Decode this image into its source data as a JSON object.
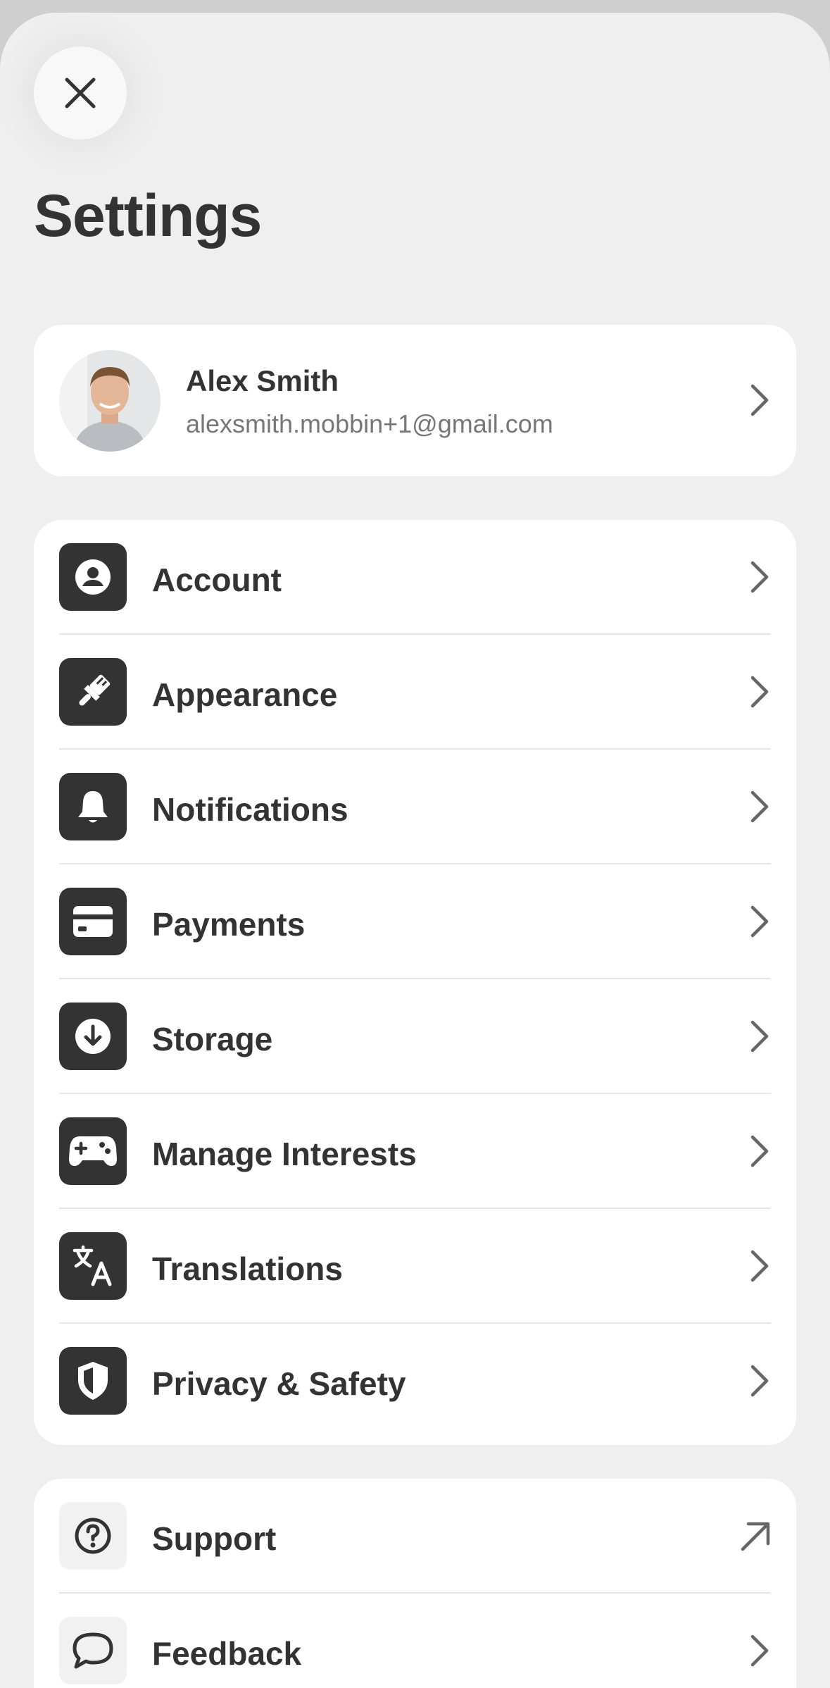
{
  "header": {
    "title": "Settings",
    "close_icon": "close-icon"
  },
  "profile": {
    "name": "Alex Smith",
    "email": "alexsmith.mobbin+1@gmail.com"
  },
  "menu_main": [
    {
      "label": "Account",
      "icon": "account-icon"
    },
    {
      "label": "Appearance",
      "icon": "paintbrush-icon"
    },
    {
      "label": "Notifications",
      "icon": "bell-icon"
    },
    {
      "label": "Payments",
      "icon": "card-icon"
    },
    {
      "label": "Storage",
      "icon": "download-icon"
    },
    {
      "label": "Manage Interests",
      "icon": "gamepad-icon"
    },
    {
      "label": "Translations",
      "icon": "translate-icon"
    },
    {
      "label": "Privacy & Safety",
      "icon": "shield-icon"
    }
  ],
  "menu_extra": [
    {
      "label": "Support",
      "icon": "question-icon",
      "trailing": "external-link-icon"
    },
    {
      "label": "Feedback",
      "icon": "chat-bubble-icon",
      "trailing": "chevron-right-icon"
    }
  ],
  "colors": {
    "sheet_bg": "#efefef",
    "card_bg": "#ffffff",
    "icon_tile_dark": "#333333",
    "text_primary": "#333333",
    "text_secondary": "#777777"
  }
}
